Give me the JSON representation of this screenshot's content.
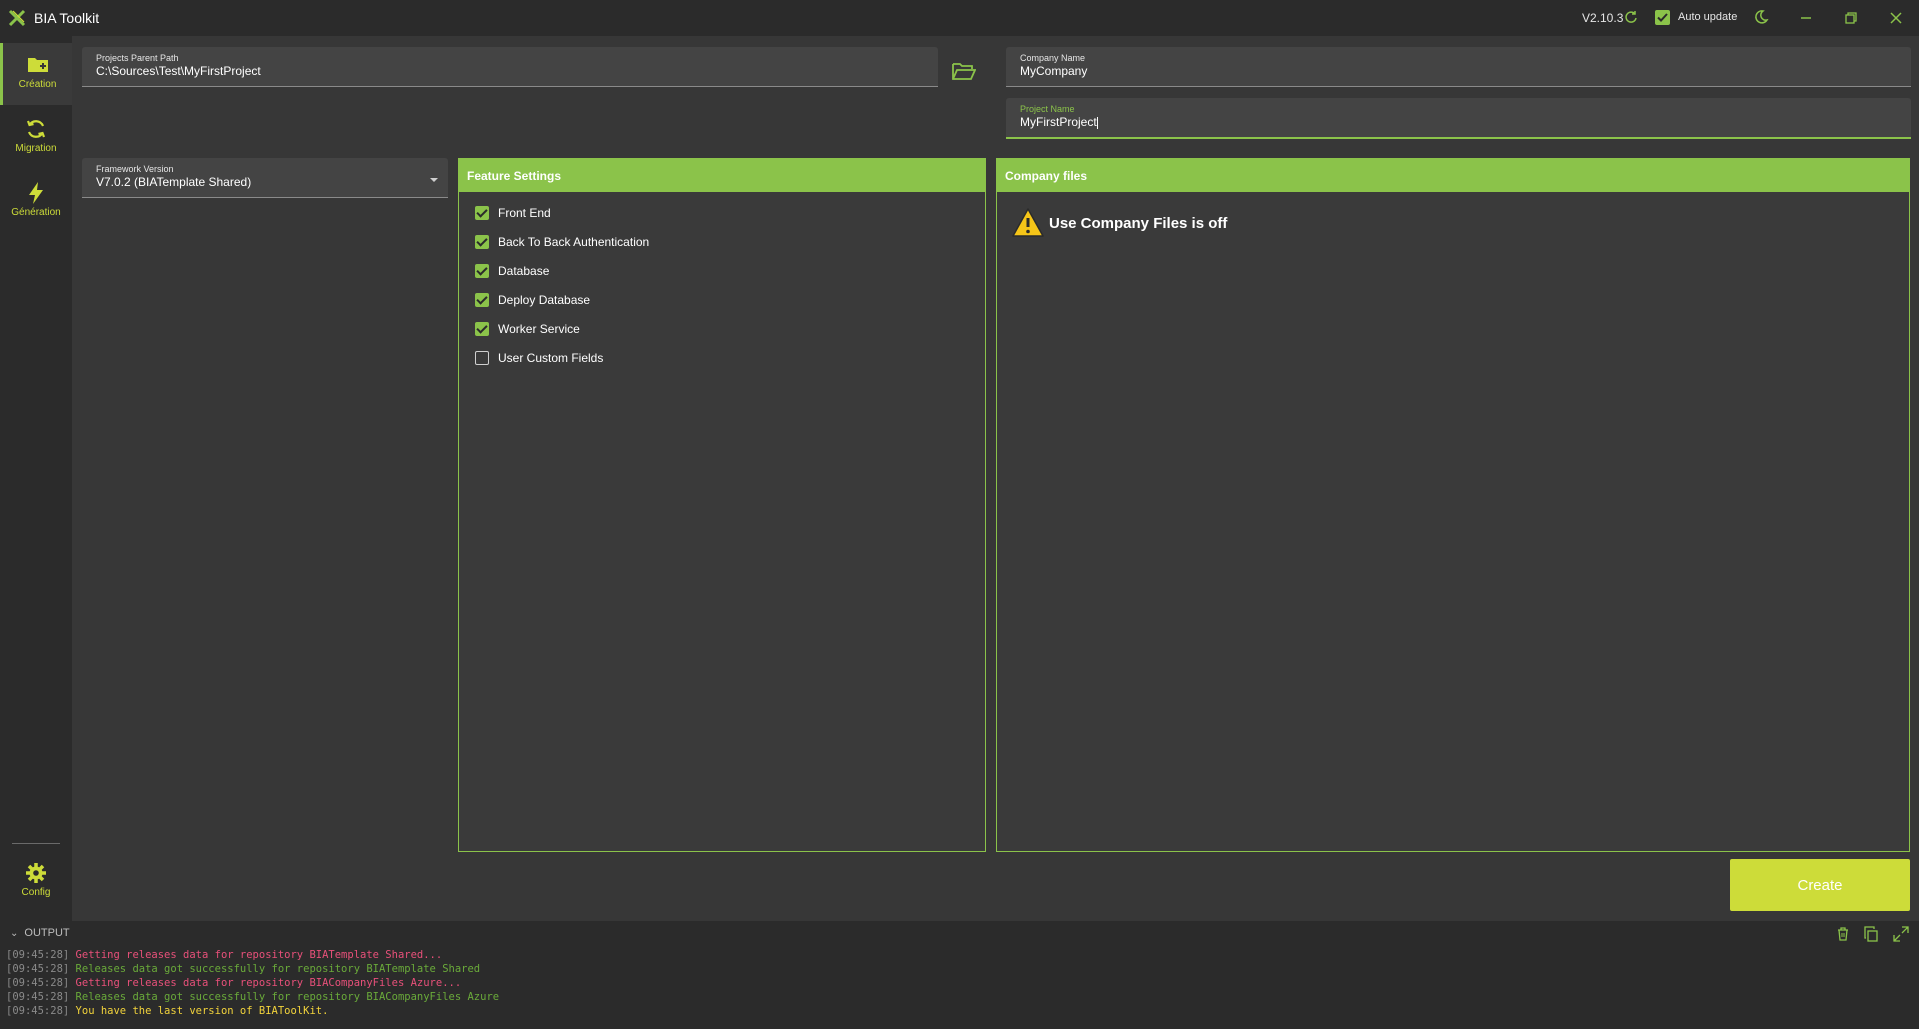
{
  "app": {
    "title": "BIA Toolkit",
    "version": "V2.10.3",
    "auto_update_label": "Auto update",
    "auto_update_checked": true,
    "accent_color": "#8bc34a",
    "create_color": "#cddc39"
  },
  "sidebar": {
    "items": [
      {
        "label": "Création",
        "icon": "folder-plus-icon",
        "active": true
      },
      {
        "label": "Migration",
        "icon": "sync-icon",
        "active": false
      },
      {
        "label": "Génération",
        "icon": "lightning-icon",
        "active": false
      }
    ],
    "config": {
      "label": "Config",
      "icon": "gear-icon"
    }
  },
  "form": {
    "projects_parent_path": {
      "label": "Projects Parent Path",
      "value": "C:\\Sources\\Test\\MyFirstProject"
    },
    "company_name": {
      "label": "Company Name",
      "value": "MyCompany"
    },
    "project_name": {
      "label": "Project Name",
      "value": "MyFirstProject"
    },
    "framework_version": {
      "label": "Framework Version",
      "value": "V7.0.2 (BIATemplate Shared)"
    }
  },
  "feature_settings": {
    "title": "Feature Settings",
    "items": [
      {
        "label": "Front End",
        "checked": true
      },
      {
        "label": "Back To Back Authentication",
        "checked": true
      },
      {
        "label": "Database",
        "checked": true
      },
      {
        "label": "Deploy Database",
        "checked": true
      },
      {
        "label": "Worker Service",
        "checked": true
      },
      {
        "label": "User Custom Fields",
        "checked": false
      }
    ]
  },
  "company_files": {
    "title": "Company files",
    "warning": "Use Company Files is off"
  },
  "actions": {
    "create_label": "Create"
  },
  "output": {
    "title": "OUTPUT",
    "lines": [
      {
        "time": "[09:45:28]",
        "text": "Getting releases data for repository BIATemplate Shared...",
        "color": "pink"
      },
      {
        "time": "[09:45:28]",
        "text": "Releases data got successfully for repository BIATemplate Shared",
        "color": "green"
      },
      {
        "time": "[09:45:28]",
        "text": "Getting releases data for repository BIACompanyFiles Azure...",
        "color": "pink"
      },
      {
        "time": "[09:45:28]",
        "text": "Releases data got successfully for repository BIACompanyFiles Azure",
        "color": "green"
      },
      {
        "time": "[09:45:28]",
        "text": "You have the last version of BIAToolKit.",
        "color": "yellow"
      }
    ]
  }
}
